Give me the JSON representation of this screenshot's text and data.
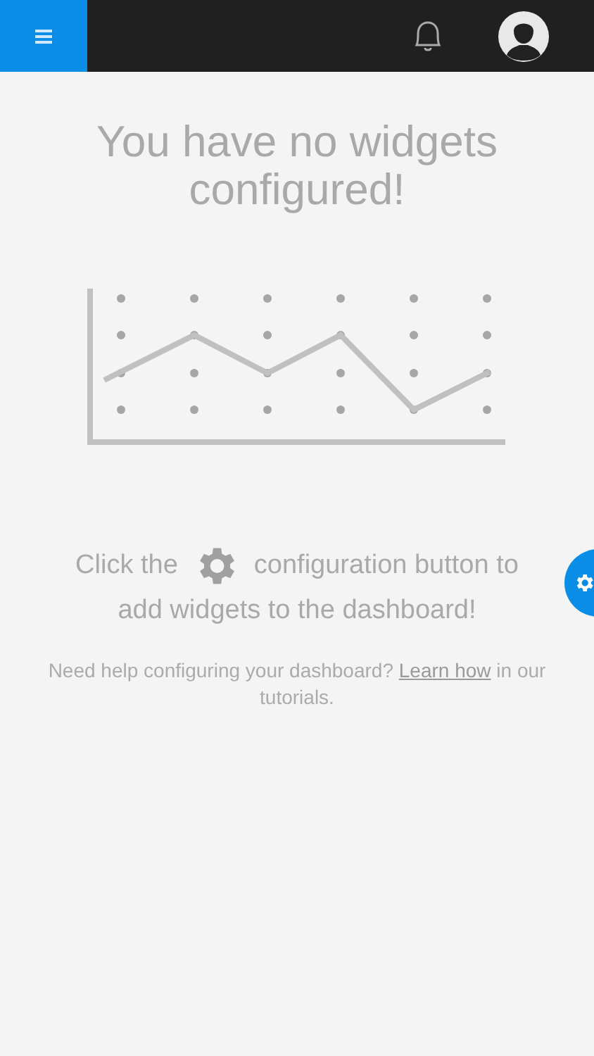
{
  "heading": "You have no widgets configured!",
  "instruction": {
    "before": "Click the",
    "after": "configuration button to",
    "continuation": "add widgets to the dashboard!"
  },
  "help": {
    "before": "Need help configuring your dashboard?",
    "link": "Learn how",
    "after": "in our tutorials."
  }
}
